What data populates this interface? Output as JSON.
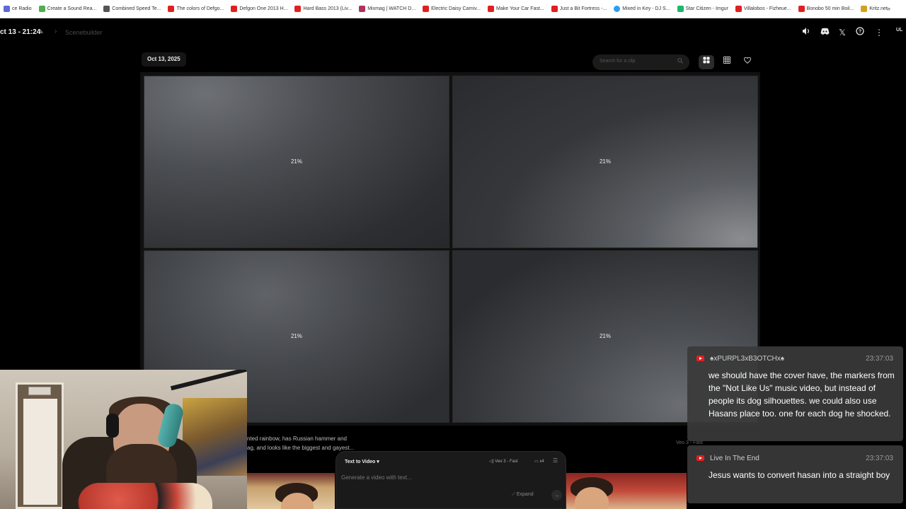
{
  "bookmarks": [
    {
      "label": "ce Radio",
      "color": "#5e6ad2"
    },
    {
      "label": "Create a Sound Rea...",
      "color": "#4caf50"
    },
    {
      "label": "Combined Speed Te...",
      "color": "#555555"
    },
    {
      "label": "The colors of Defgo...",
      "color": "#e02020"
    },
    {
      "label": "Defgon One 2013 H...",
      "color": "#e02020"
    },
    {
      "label": "Hard Bass 2013 (Liv...",
      "color": "#e02020"
    },
    {
      "label": "Mixmag | WATCH D...",
      "color": "#b03060"
    },
    {
      "label": "Electric Daisy Carniv...",
      "color": "#e02020"
    },
    {
      "label": "Make Your Car Fast...",
      "color": "#e02020"
    },
    {
      "label": "Just a Bit Fortress -...",
      "color": "#e02020"
    },
    {
      "label": "Mixed in Key - DJ S...",
      "color": "#2a9df4"
    },
    {
      "label": "Star Citizen - Imgur",
      "color": "#1bb76e"
    },
    {
      "label": "Villalobos - Fizheue...",
      "color": "#e02020"
    },
    {
      "label": "Bonobo 50 min Boil...",
      "color": "#e02020"
    },
    {
      "label": "Kritz.net",
      "color": "#d4a020"
    }
  ],
  "header": {
    "title": "ct 13 - 21:24",
    "breadcrumb": "Scenebuilder",
    "avatar": "UL"
  },
  "toolbar": {
    "date": "Oct 13, 2025",
    "search_placeholder": "Search for a clip"
  },
  "clips": [
    {
      "progress": "21%"
    },
    {
      "progress": "21%"
    },
    {
      "progress": "21%"
    },
    {
      "progress": "21%"
    }
  ],
  "prompt": {
    "line1": "nted rainbow, has Russian hammer and",
    "line2": "ag, and looks like the biggest and gayest...",
    "model_small": "Veo 3 - Fast"
  },
  "generator": {
    "mode": "Text to Video",
    "model": "Veo 3 - Fast",
    "count": "x4",
    "input_placeholder": "Generate a video with text...",
    "expand": "Expand"
  },
  "chat": [
    {
      "author": "♠xPURPL3xB3OTCHx♠",
      "time": "23:37:03",
      "text": "we should have the cover have, the markers from the \"Not Like Us\" music video, but instead of people its dog silhouettes. we could also use Hasans place too. one for each dog he shocked."
    },
    {
      "author": "Live In The End",
      "time": "23:37:03",
      "text": "Jesus wants to convert hasan into a straight boy"
    }
  ],
  "colors": {
    "accent_youtube": "#e02020",
    "background": "#000000",
    "chat_bubble": "#3a3a3a"
  }
}
